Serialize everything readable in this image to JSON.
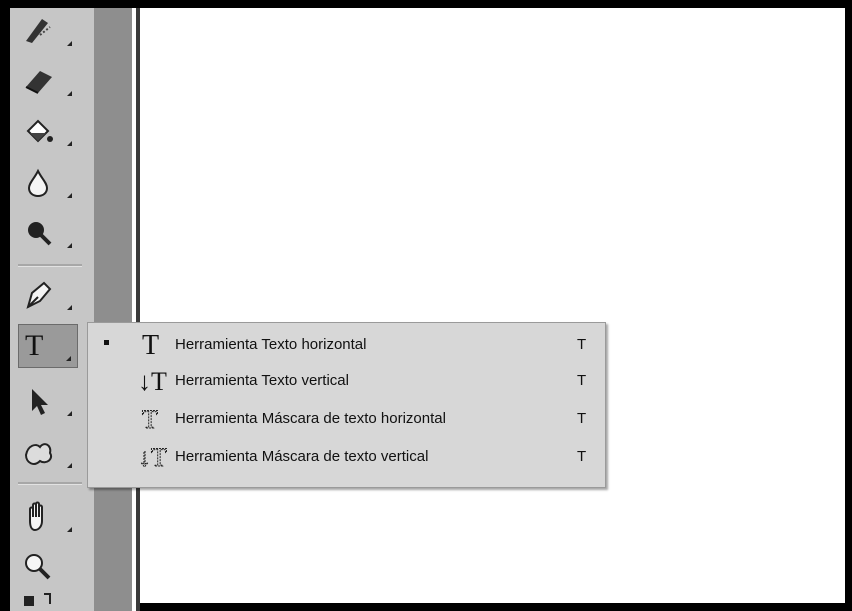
{
  "toolbar": {
    "tools": [
      {
        "name": "history-brush-icon"
      },
      {
        "name": "eraser-icon"
      },
      {
        "name": "paint-bucket-icon"
      },
      {
        "name": "blur-icon"
      },
      {
        "name": "dodge-icon"
      },
      {
        "name": "pen-icon"
      },
      {
        "name": "type-tool-icon",
        "glyph": "T"
      },
      {
        "name": "path-selection-icon"
      },
      {
        "name": "custom-shape-icon"
      },
      {
        "name": "hand-icon"
      },
      {
        "name": "zoom-icon"
      }
    ]
  },
  "flyout": {
    "items": [
      {
        "label": "Herramienta Texto horizontal",
        "shortcut": "T",
        "selected": true,
        "icon": "horizontal-type-icon",
        "glyph": "T"
      },
      {
        "label": "Herramienta Texto vertical",
        "shortcut": "T",
        "selected": false,
        "icon": "vertical-type-icon",
        "glyph": "↓T"
      },
      {
        "label": "Herramienta Máscara de texto horizontal",
        "shortcut": "T",
        "selected": false,
        "icon": "horizontal-type-mask-icon",
        "glyph": "T"
      },
      {
        "label": "Herramienta Máscara de texto vertical",
        "shortcut": "T",
        "selected": false,
        "icon": "vertical-type-mask-icon",
        "glyph": "↓T"
      }
    ]
  }
}
